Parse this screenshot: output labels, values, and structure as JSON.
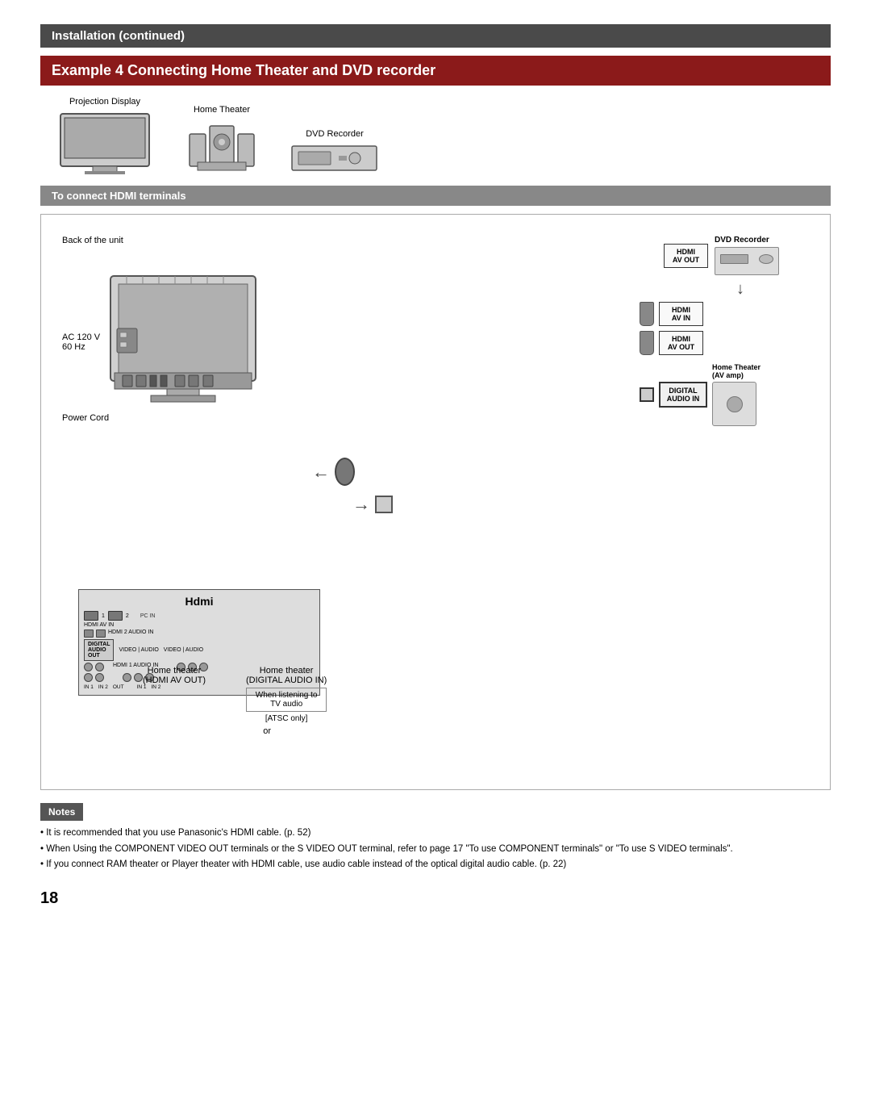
{
  "installation_header": "Installation (continued)",
  "example_header": "Example 4    Connecting Home Theater and DVD recorder",
  "hdmi_section": "To connect HDMI terminals",
  "device_labels": {
    "projection_display": "Projection Display",
    "home_theater": "Home Theater",
    "dvd_recorder": "DVD Recorder"
  },
  "diagram_labels": {
    "back_of_unit": "Back of the unit",
    "ac": "AC 120 V\n60 Hz",
    "power_cord": "Power Cord",
    "or_text": "or",
    "when_listening": "When listening to",
    "tv_audio": "TV audio",
    "atsc_only": "[ATSC only]"
  },
  "right_panel": {
    "hdmi_av_out_label": "HDMI\nAV OUT",
    "dvd_recorder_label": "DVD Recorder",
    "hdmi_av_in_label": "HDMI\nAV IN",
    "hdmi_av_out2_label": "HDMI\nAV OUT",
    "digital_audio_in_label": "DIGITAL\nAUDIO IN",
    "home_theater_label": "Home Theater\n(AV amp)"
  },
  "ports": {
    "hdmi_label": "HDMI",
    "hdmi_av_in": "HDMI AV IN",
    "hdmi2_audio_in": "HDMI 2\nAUDIO IN",
    "hdmi1_audio_in": "HDMI 1\nAUDIO IN",
    "digital_audio_out": "DIGITAL\nAUDIO\nOUT",
    "video_audio": "VIDEO | AUDIO",
    "pc_in": "PC IN"
  },
  "bottom_labels": {
    "home_theater_hdmi": "Home theater\n(HDMI AV OUT)",
    "home_theater_digital": "Home theater\n(DIGITAL AUDIO IN)"
  },
  "notes": {
    "header": "Notes",
    "items": [
      "It is recommended that you use Panasonic's HDMI cable. (p. 52)",
      "When Using the COMPONENT VIDEO OUT terminals or the S VIDEO OUT terminal, refer to page 17 \"To use COMPONENT terminals\" or \"To use S VIDEO terminals\".",
      "If you connect RAM theater or Player theater with HDMI cable, use audio cable instead of the optical digital audio cable. (p. 22)"
    ]
  },
  "page_number": "18"
}
